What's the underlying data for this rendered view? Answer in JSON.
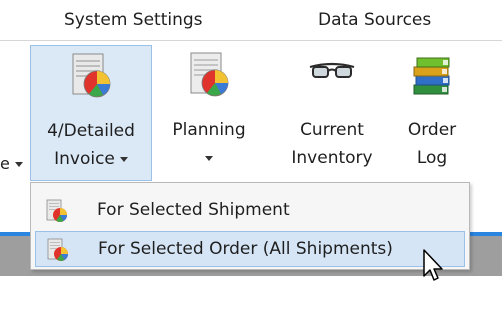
{
  "tabs": {
    "system_settings": "System Settings",
    "data_sources": "Data Sources"
  },
  "ribbon": {
    "left_fragment": "e",
    "buttons": {
      "detailed_invoice": {
        "line1": "4/Detailed",
        "line2": "Invoice",
        "icon": "invoice-chart-icon"
      },
      "planning": {
        "line1": "Planning",
        "icon": "planning-chart-icon"
      },
      "current_inventory": {
        "line1": "Current",
        "line2": "Inventory",
        "icon": "glasses-icon"
      },
      "order_log": {
        "line1": "Order",
        "line2": "Log",
        "icon": "books-icon"
      }
    }
  },
  "menu": {
    "items": [
      {
        "label": "For Selected Shipment",
        "icon": "invoice-chart-icon"
      },
      {
        "label": "For Selected Order (All Shipments)",
        "icon": "invoice-chart-icon"
      }
    ]
  },
  "colors": {
    "highlight": "#dbe9f7",
    "highlight_border": "#9cc1e6",
    "strip": "#9e9e9e",
    "accent_blue": "#2a85e0"
  }
}
